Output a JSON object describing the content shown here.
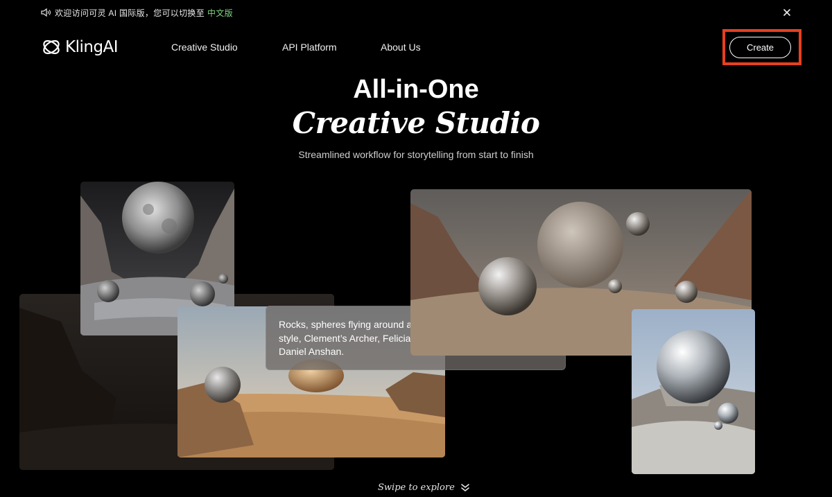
{
  "announcement": {
    "icon": "speaker-icon",
    "message": "欢迎访问可灵 AI 国际版，您可以切换至",
    "link_label": "中文版",
    "close_icon": "close-icon"
  },
  "nav": {
    "logo_text": "KlingAI",
    "links": [
      "Creative Studio",
      "API Platform",
      "About Us"
    ],
    "create_label": "Create"
  },
  "hero": {
    "line1": "All-in-One",
    "line2": "Creative Studio",
    "subtitle": "Streamlined workflow for storytelling from start to finish"
  },
  "prompt": {
    "text": "Rocks, spheres flying around a silver mirrored moon, digital art style, Clement’s Archer, Felicia Simon, Vray, desert-wave, Daniel Anshan."
  },
  "footer": {
    "swipe_label": "Swipe to explore",
    "swipe_icon": "double-chevron-down-icon"
  },
  "colors": {
    "background": "#000000",
    "link_green": "#7fd67f",
    "highlight": "#e8401f"
  }
}
